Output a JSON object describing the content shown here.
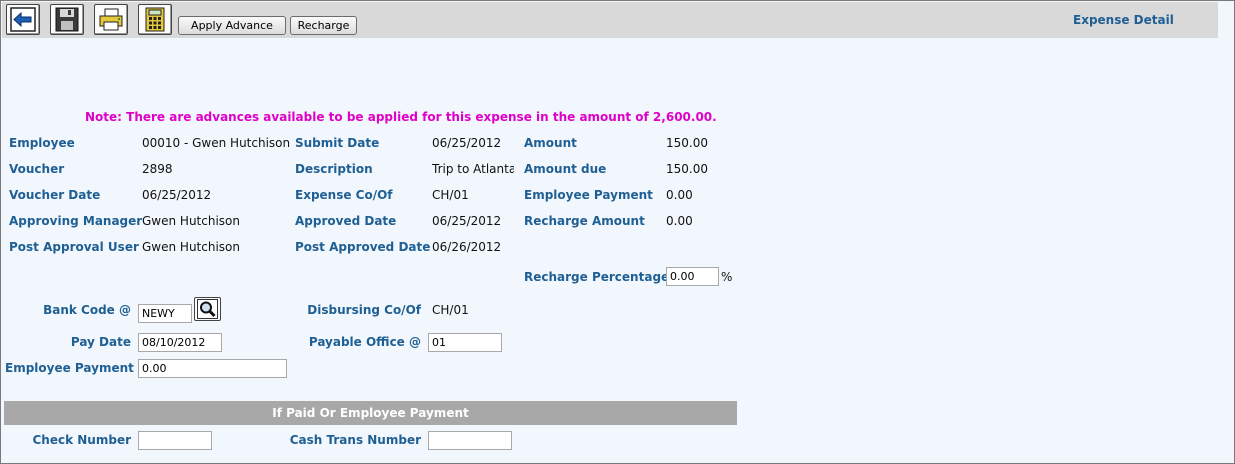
{
  "toolbar": {
    "apply_advance_label": "Apply Advance",
    "recharge_label": "Recharge",
    "icons": [
      "back-arrow-icon",
      "save-disk-icon",
      "print-icon",
      "calculator-icon"
    ]
  },
  "page_title": "Expense Detail",
  "note": "Note: There are advances available to be applied for this expense in the amount of 2,600.00.",
  "details": {
    "employee_label": "Employee",
    "employee_value": "00010 - Gwen Hutchison",
    "voucher_label": "Voucher",
    "voucher_value": "2898",
    "voucher_date_label": "Voucher Date",
    "voucher_date_value": "06/25/2012",
    "approving_manager_label": "Approving Manager",
    "approving_manager_value": "Gwen Hutchison",
    "post_approval_user_label": "Post Approval User",
    "post_approval_user_value": "Gwen Hutchison",
    "submit_date_label": "Submit Date",
    "submit_date_value": "06/25/2012",
    "description_label": "Description",
    "description_value": "Trip to Atlanta",
    "expense_coof_label": "Expense Co/Of",
    "expense_coof_value": "CH/01",
    "approved_date_label": "Approved Date",
    "approved_date_value": "06/25/2012",
    "post_approved_date_label": "Post Approved Date",
    "post_approved_date_value": "06/26/2012",
    "amount_label": "Amount",
    "amount_value": "150.00",
    "amount_due_label": "Amount due",
    "amount_due_value": "150.00",
    "employee_payment_label": "Employee Payment",
    "employee_payment_value": "0.00",
    "recharge_amount_label": "Recharge Amount",
    "recharge_amount_value": "0.00",
    "recharge_percentage_label": "Recharge Percentage",
    "recharge_percentage_value": "0.00",
    "percent_sign": "%"
  },
  "payment": {
    "bank_code_label": "Bank Code @",
    "bank_code_value": "NEWY",
    "pay_date_label": "Pay Date",
    "pay_date_value": "08/10/2012",
    "employee_payment_label": "Employee Payment",
    "employee_payment_value": "0.00",
    "disbursing_coof_label": "Disbursing Co/Of",
    "disbursing_coof_value": "CH/01",
    "payable_office_label": "Payable Office @",
    "payable_office_value": "01"
  },
  "paid_section": {
    "title": "If Paid Or Employee Payment",
    "check_number_label": "Check Number",
    "check_number_value": "",
    "cash_trans_number_label": "Cash Trans Number",
    "cash_trans_number_value": ""
  }
}
